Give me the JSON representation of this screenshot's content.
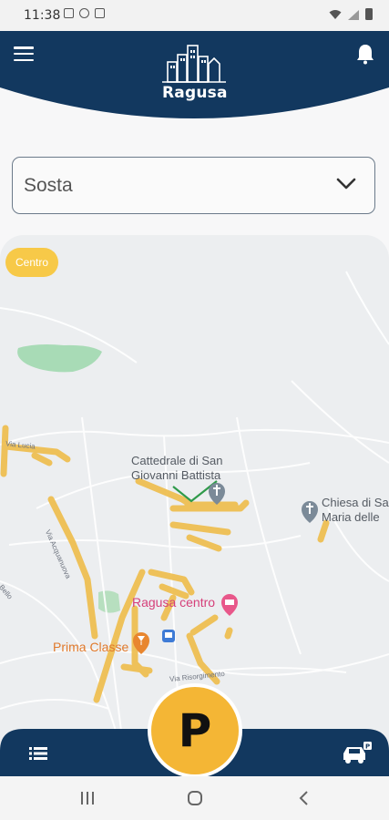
{
  "status_bar": {
    "time": "11:38"
  },
  "header": {
    "app_name": "Ragusa",
    "brand_color": "#12385f"
  },
  "dropdown": {
    "selected": "Sosta"
  },
  "map": {
    "zone_chip": "Centro",
    "labels": {
      "cathedral_line1": "Cattedrale di San",
      "cathedral_line2": "Giovanni Battista",
      "church_line1": "Chiesa di Sa",
      "church_line2": "Maria delle",
      "ragusa_centro": "Ragusa centro",
      "prima_classe": "Prima Classe",
      "via_risorgimento": "Via Risorgimento",
      "via_acquanuova": "Via Acquanuova",
      "via_lucia": "Via Lucia",
      "bello": "Bello"
    },
    "parking_color": "#f4b635"
  },
  "parking_button": {
    "label": "P"
  }
}
